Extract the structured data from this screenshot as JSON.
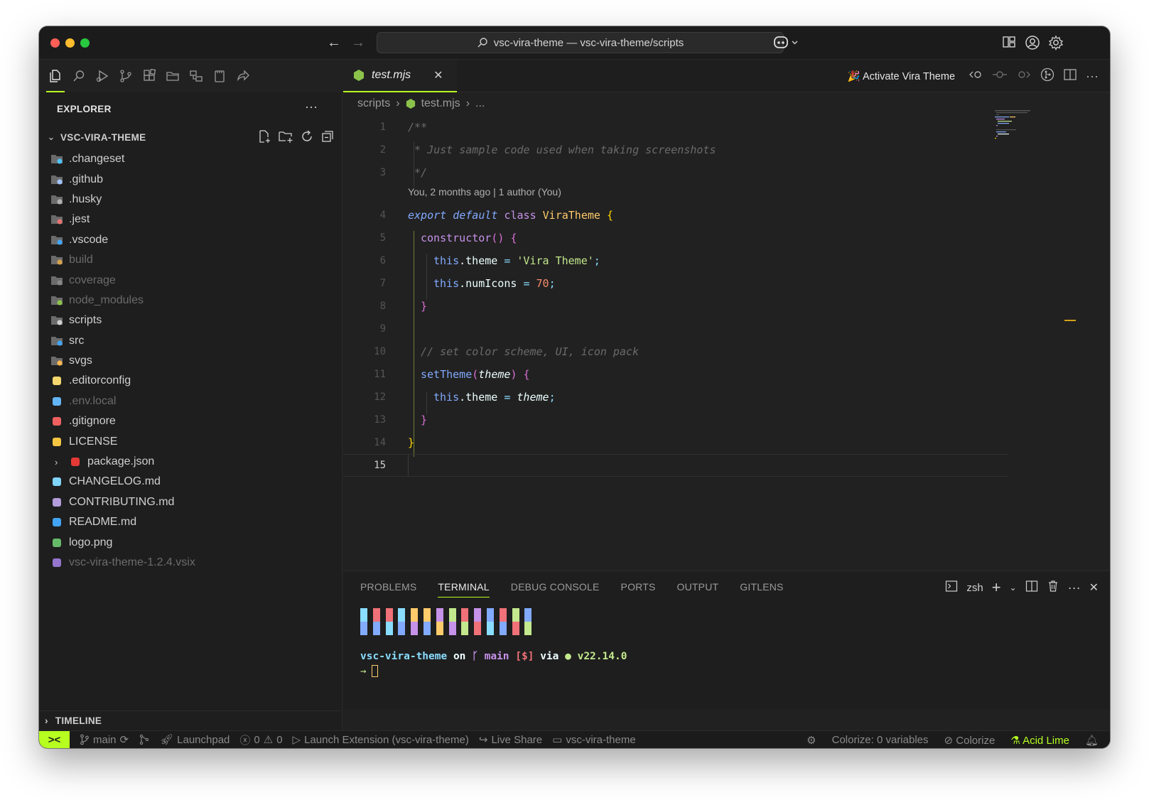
{
  "window": {
    "title": "vsc-vira-theme — vsc-vira-theme/scripts"
  },
  "sidebar": {
    "title": "EXPLORER",
    "root": "VSC-VIRA-THEME",
    "files": [
      {
        "label": ".changeset",
        "icon": "folder-changeset-icon",
        "dim": false,
        "color": "#4fc3f7"
      },
      {
        "label": ".github",
        "icon": "folder-github-icon",
        "dim": false,
        "color": "#a0c4ff"
      },
      {
        "label": ".husky",
        "icon": "folder-husky-icon",
        "dim": false,
        "color": "#b0b0b0"
      },
      {
        "label": ".jest",
        "icon": "folder-jest-icon",
        "dim": false,
        "color": "#e57373"
      },
      {
        "label": ".vscode",
        "icon": "folder-vscode-icon",
        "dim": false,
        "color": "#42a5f5"
      },
      {
        "label": "build",
        "icon": "folder-build-icon",
        "dim": true,
        "color": "#d7a24a"
      },
      {
        "label": "coverage",
        "icon": "folder-coverage-icon",
        "dim": true,
        "color": "#888888"
      },
      {
        "label": "node_modules",
        "icon": "folder-node-icon",
        "dim": true,
        "color": "#8bc34a"
      },
      {
        "label": "scripts",
        "icon": "folder-scripts-icon",
        "dim": false,
        "color": "#cfcfcf"
      },
      {
        "label": "src",
        "icon": "folder-src-icon",
        "dim": false,
        "color": "#42a5f5"
      },
      {
        "label": "svgs",
        "icon": "folder-svg-icon",
        "dim": false,
        "color": "#ffb74d"
      },
      {
        "label": ".editorconfig",
        "icon": "editorconfig-icon",
        "dim": false,
        "color": "#f5d76e"
      },
      {
        "label": ".env.local",
        "icon": "env-icon",
        "dim": true,
        "color": "#64b5f6"
      },
      {
        "label": ".gitignore",
        "icon": "git-icon",
        "dim": false,
        "color": "#f06060"
      },
      {
        "label": "LICENSE",
        "icon": "license-icon",
        "dim": false,
        "color": "#f5c542"
      },
      {
        "label": "package.json",
        "icon": "npm-icon",
        "dim": false,
        "color": "#e53935",
        "nested": true
      },
      {
        "label": "CHANGELOG.md",
        "icon": "changelog-icon",
        "dim": false,
        "color": "#81d4fa"
      },
      {
        "label": "CONTRIBUTING.md",
        "icon": "contributing-icon",
        "dim": false,
        "color": "#b39ddb"
      },
      {
        "label": "README.md",
        "icon": "info-icon",
        "dim": false,
        "color": "#42a5f5"
      },
      {
        "label": "logo.png",
        "icon": "image-icon",
        "dim": false,
        "color": "#66bb6a"
      },
      {
        "label": "vsc-vira-theme-1.2.4.vsix",
        "icon": "vsix-icon",
        "dim": true,
        "color": "#9575cd"
      }
    ],
    "timeline": "TIMELINE"
  },
  "editor": {
    "tab": "test.mjs",
    "activate": "🎉 Activate Vira Theme",
    "breadcrumb": [
      "scripts",
      "test.mjs",
      "..."
    ],
    "blame": "You, 2 months ago | 1 author (You)",
    "line_numbers": [
      "1",
      "2",
      "3",
      "4",
      "5",
      "6",
      "7",
      "8",
      "9",
      "10",
      "11",
      "12",
      "13",
      "14",
      "15"
    ],
    "code": {
      "l1": "/**",
      "l2": " * Just sample code used when taking screenshots",
      "l3": " */",
      "l4_kw1": "export",
      "l4_kw2": "default",
      "l4_cls": "class",
      "l4_name": "ViraTheme",
      "l4_br": "{",
      "l5_fn": "constructor",
      "l5_paren": "()",
      "l5_br": "{",
      "l6_this": "this",
      "l6_prop": ".theme",
      "l6_op": "=",
      "l6_str": "'Vira Theme'",
      "l6_end": ";",
      "l7_this": "this",
      "l7_prop": ".numIcons",
      "l7_op": "=",
      "l7_num": "70",
      "l7_end": ";",
      "l8_br": "}",
      "l10": "// set color scheme, UI, icon pack",
      "l11_fn": "setTheme",
      "l11_po": "(",
      "l11_param": "theme",
      "l11_pc": ")",
      "l11_br": "{",
      "l12_this": "this",
      "l12_prop": ".theme",
      "l12_op": "=",
      "l12_val": "theme",
      "l12_end": ";",
      "l13_br": "}",
      "l14_br": "}"
    }
  },
  "panel": {
    "tabs": [
      "PROBLEMS",
      "TERMINAL",
      "DEBUG CONSOLE",
      "PORTS",
      "OUTPUT",
      "GITLENS"
    ],
    "active_tab": "TERMINAL",
    "shell": "zsh",
    "prompt": {
      "dir": "vsc-vira-theme",
      "on": "on",
      "branch_icon": "ᚴ",
      "branch": "main",
      "status": "[$]",
      "via": "via",
      "node_dot": "●",
      "node": "v22.14.0",
      "arrow": "→"
    },
    "color_bars": [
      [
        "#89ddff",
        "#82aaff"
      ],
      [
        "#f07178",
        "#82aaff"
      ],
      [
        "#f07178",
        "#89ddff"
      ],
      [
        "#89ddff",
        "#82aaff"
      ],
      [
        "#ffcb6b",
        "#c792ea"
      ],
      [
        "#ffcb6b",
        "#82aaff"
      ],
      [
        "#c792ea",
        "#ffcb6b"
      ],
      [
        "#c3e88d",
        "#c792ea"
      ],
      [
        "#f07178",
        "#c3e88d"
      ],
      [
        "#c792ea",
        "#f07178"
      ],
      [
        "#82aaff",
        "#89ddff"
      ],
      [
        "#f07178",
        "#82aaff"
      ],
      [
        "#c3e88d",
        "#f07178"
      ],
      [
        "#82aaff",
        "#c3e88d"
      ]
    ]
  },
  "statusbar": {
    "branch": "main",
    "launchpad": "Launchpad",
    "errors": "0",
    "warnings": "0",
    "launch": "Launch Extension (vsc-vira-theme)",
    "liveshare": "Live Share",
    "folder": "vsc-vira-theme",
    "colorize_vars": "Colorize: 0 variables",
    "colorize": "Colorize",
    "theme": "Acid Lime"
  },
  "colors": {
    "accent": "#b6ff20",
    "background": "#212121"
  }
}
